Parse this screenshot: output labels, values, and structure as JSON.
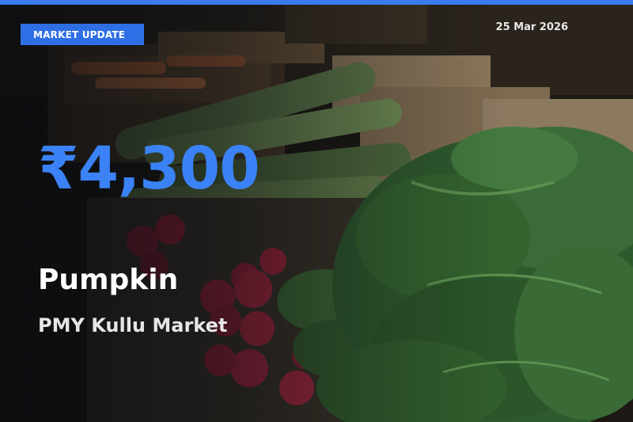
{
  "badge": {
    "label": "MARKET UPDATE"
  },
  "date": "25 Mar 2026",
  "price": "₹4,300",
  "commodity": "Pumpkin",
  "market": "PMY Kullu Market",
  "colors": {
    "accent": "#3b82f6",
    "badge_bg": "#2f6fe6",
    "top_bar": "#3a7bf0",
    "title": "#ffffff"
  }
}
